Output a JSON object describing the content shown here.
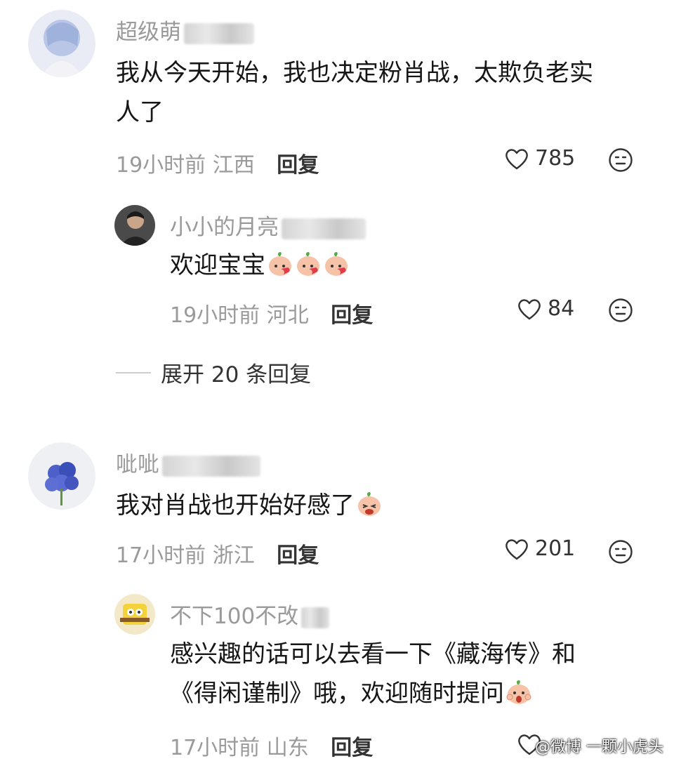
{
  "comments": [
    {
      "username": "超级萌",
      "text_lines": [
        "我从今天开始，我也决定粉肖战，太欺负老实",
        "人了"
      ],
      "time": "19小时前",
      "location": "江西",
      "reply_label": "回复",
      "likes": "785"
    },
    {
      "username": "小小的月亮",
      "text": "欢迎宝宝",
      "time": "19小时前",
      "location": "河北",
      "reply_label": "回复",
      "likes": "84"
    },
    {
      "expand_label": "展开 20 条回复"
    },
    {
      "username": "呲呲",
      "text": "我对肖战也开始好感了",
      "time": "17小时前",
      "location": "浙江",
      "reply_label": "回复",
      "likes": "201"
    },
    {
      "username": "不下100不改",
      "text_lines": [
        "感兴趣的话可以去看一下《藏海传》和",
        "《得闲谨制》哦，欢迎随时提问"
      ],
      "time": "17小时前",
      "location": "山东",
      "reply_label": "回复"
    }
  ],
  "watermark": "@微博 一颗小虎头",
  "colors": {
    "text": "#161616",
    "meta": "#9a9a9a",
    "accent": "#333333"
  },
  "icons": [
    "heart-icon",
    "emoji-react-icon",
    "peach-emoji"
  ]
}
